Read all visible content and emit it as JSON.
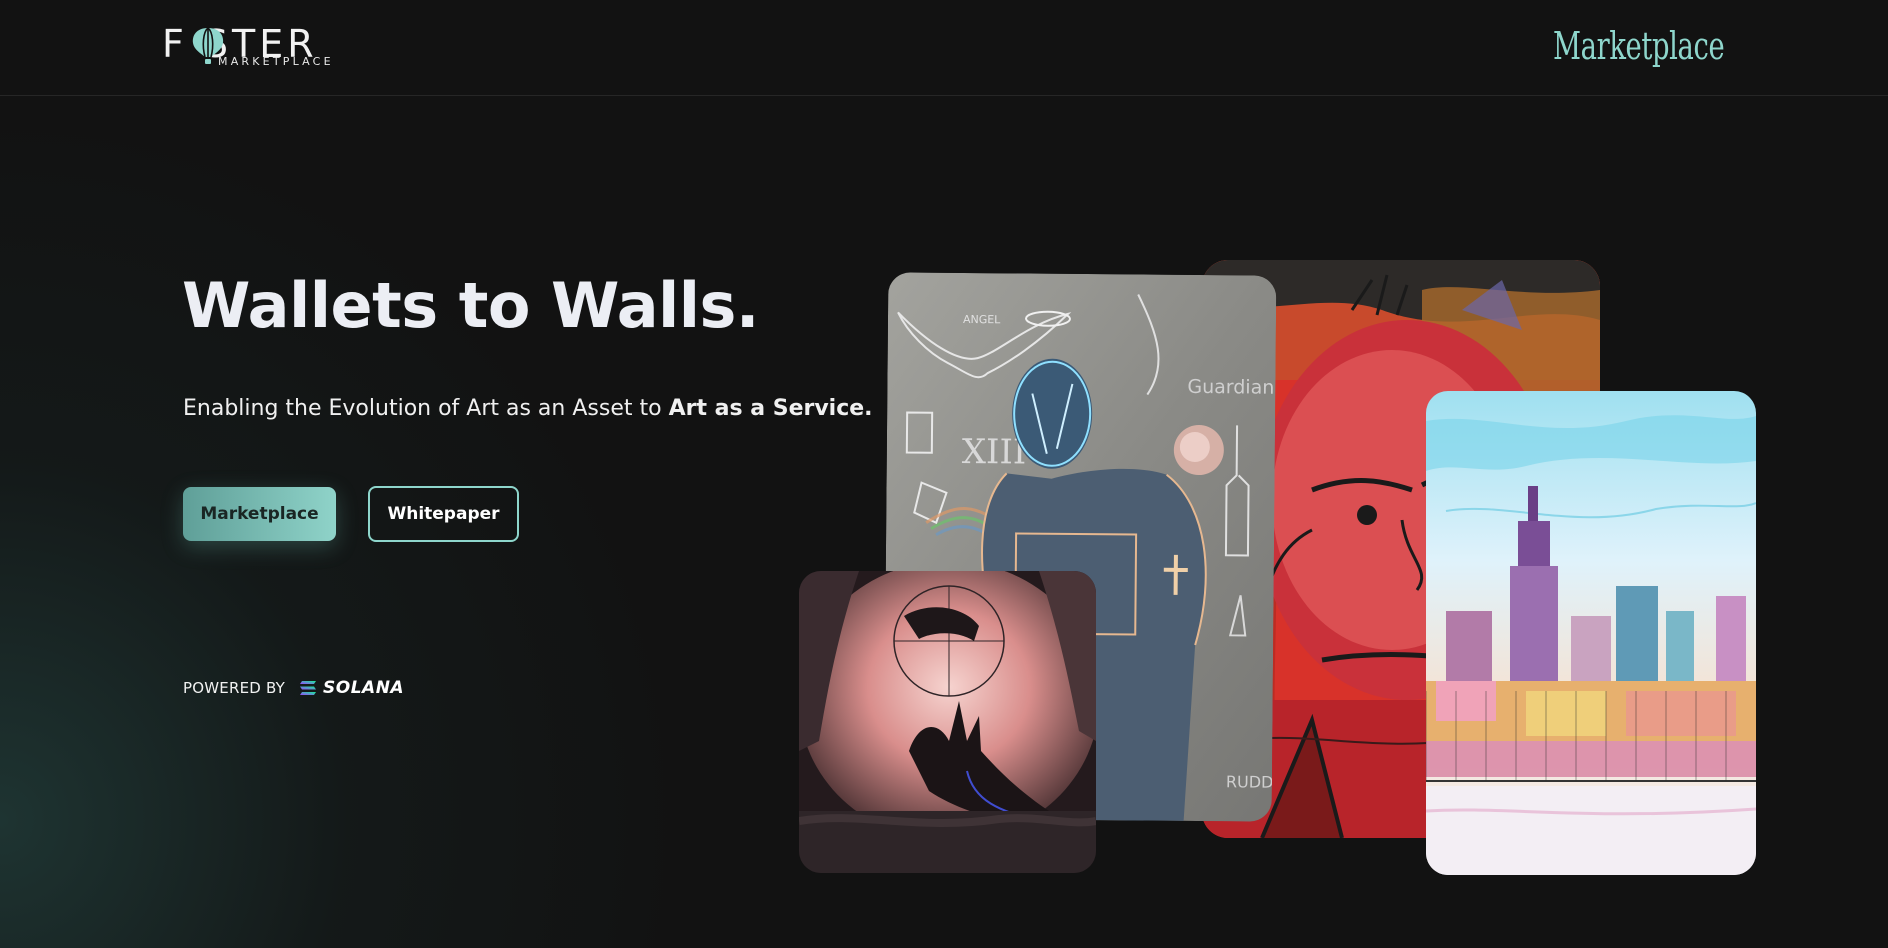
{
  "header": {
    "logo_text": "F STER",
    "logo_sub": "MARKETPLACE",
    "nav_marketplace": "Marketplace"
  },
  "hero": {
    "title": "Wallets to Walls.",
    "subtitle_prefix": "Enabling the Evolution of Art as an Asset to ",
    "subtitle_bold": "Art as a Service.",
    "primary_button": "Marketplace",
    "secondary_button": "Whitepaper"
  },
  "powered": {
    "label": "POWERED BY",
    "brand": "SOLANA"
  },
  "gallery": {
    "items": [
      {
        "name": "angel-guardian-artwork",
        "text_1": "XIII",
        "text_2": "Guardian",
        "text_3": "ANGEL",
        "text_4": "RUDD"
      },
      {
        "name": "red-face-portrait-artwork"
      },
      {
        "name": "city-skyline-artwork"
      },
      {
        "name": "floating-hand-artwork"
      }
    ]
  },
  "colors": {
    "background": "#121212",
    "accent": "#8ed6cc",
    "accent_dark": "#5f9f98"
  }
}
